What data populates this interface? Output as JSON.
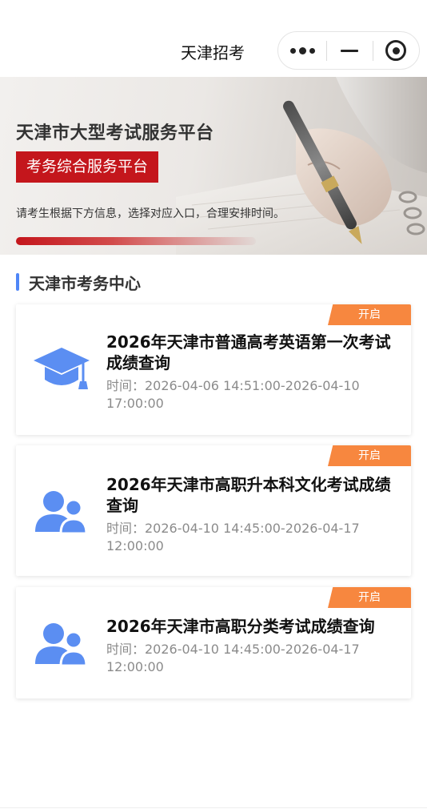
{
  "header": {
    "title": "天津招考",
    "capsule": {
      "more_icon": "more-dots-icon",
      "minimize_icon": "minus-icon",
      "close_icon": "target-circle-icon"
    }
  },
  "banner": {
    "title": "天津市大型考试服务平台",
    "tag": "考务综合服务平台",
    "description": "请考生根据下方信息，选择对应入口，合理安排时间。",
    "accent_color": "#c4161c"
  },
  "section": {
    "title": "天津市考务中心",
    "accent_color": "#4f86f7"
  },
  "cards": [
    {
      "badge": "开启",
      "icon": "graduation-cap-icon",
      "title": "2026年天津市普通高考英语第一次考试成绩查询",
      "time": "时间：2026-04-06 14:51:00-2026-04-10 17:00:00"
    },
    {
      "badge": "开启",
      "icon": "users-icon",
      "title": "2026年天津市高职升本科文化考试成绩查询",
      "time": "时间：2026-04-10 14:45:00-2026-04-17 12:00:00"
    },
    {
      "badge": "开启",
      "icon": "users-icon",
      "title": "2026年天津市高职分类考试成绩查询",
      "time": "时间：2026-04-10 14:45:00-2026-04-17 12:00:00"
    }
  ],
  "colors": {
    "badge": "#f7873f",
    "icon": "#5b8ef2"
  }
}
